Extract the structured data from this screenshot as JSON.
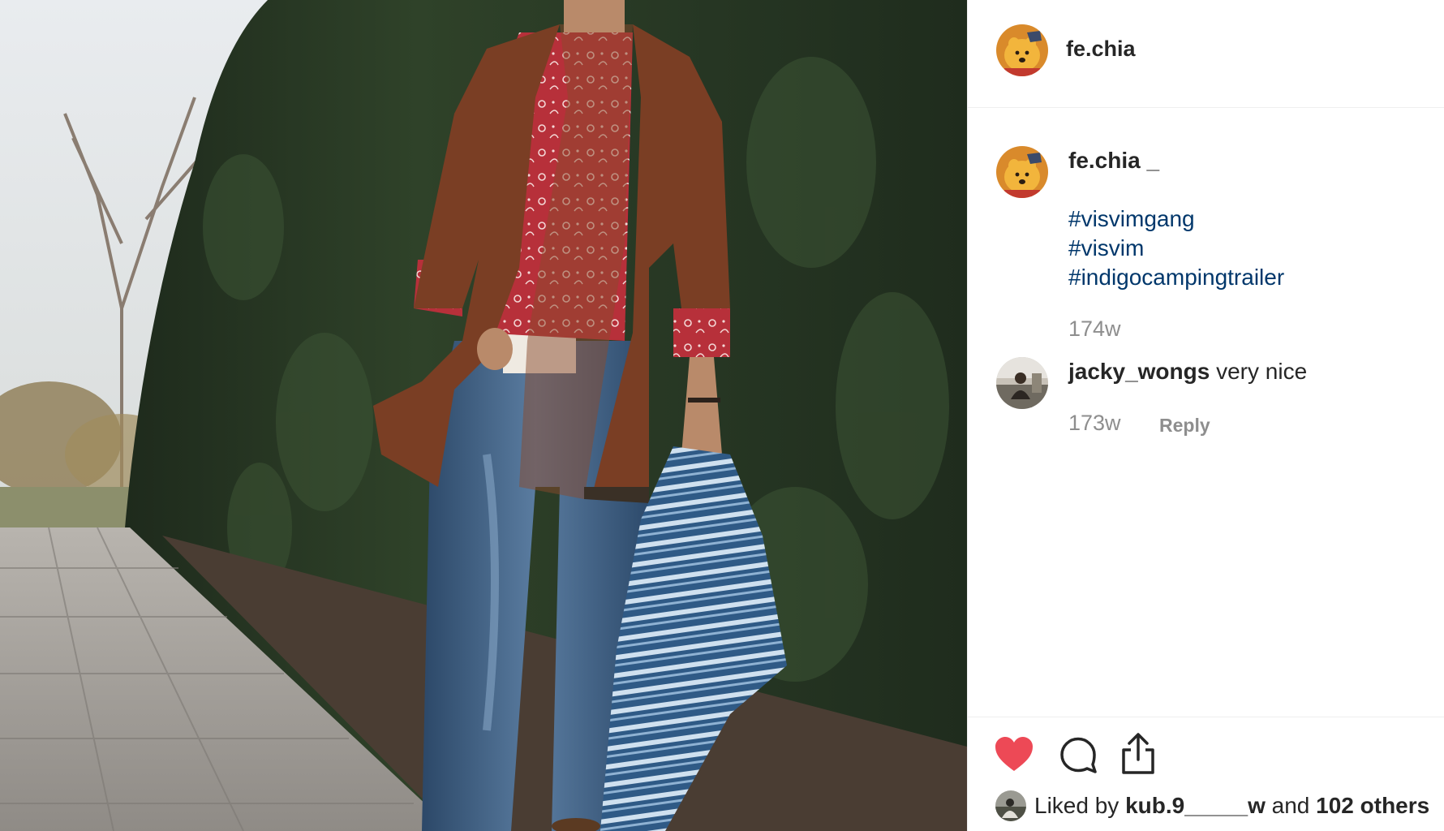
{
  "post": {
    "username": "fe.chia",
    "image_alt": "Man wearing brown cardigan, red bandana-print shirt and blue jeans holding an indigo striped blanket in front of a hedge"
  },
  "caption": {
    "author": "fe.chia _",
    "hashtags": [
      "#visvimgang",
      "#visvim",
      "#indigocampingtrailer"
    ],
    "time": "174w"
  },
  "comment": {
    "author": "jacky_wongs",
    "text": "very nice",
    "time": "173w",
    "reply_label": "Reply"
  },
  "likes": {
    "prefix": "Liked by",
    "liker": "kub.9_____w",
    "connector": "and",
    "others": "102 others"
  },
  "colors": {
    "like_red": "#ed4956",
    "hashtag_blue": "#00376b",
    "meta_gray": "#8e8e8e",
    "text_dark": "#262626"
  },
  "icons": {
    "like": "heart-filled-icon",
    "comment": "speech-bubble-icon",
    "share": "share-upload-icon"
  }
}
